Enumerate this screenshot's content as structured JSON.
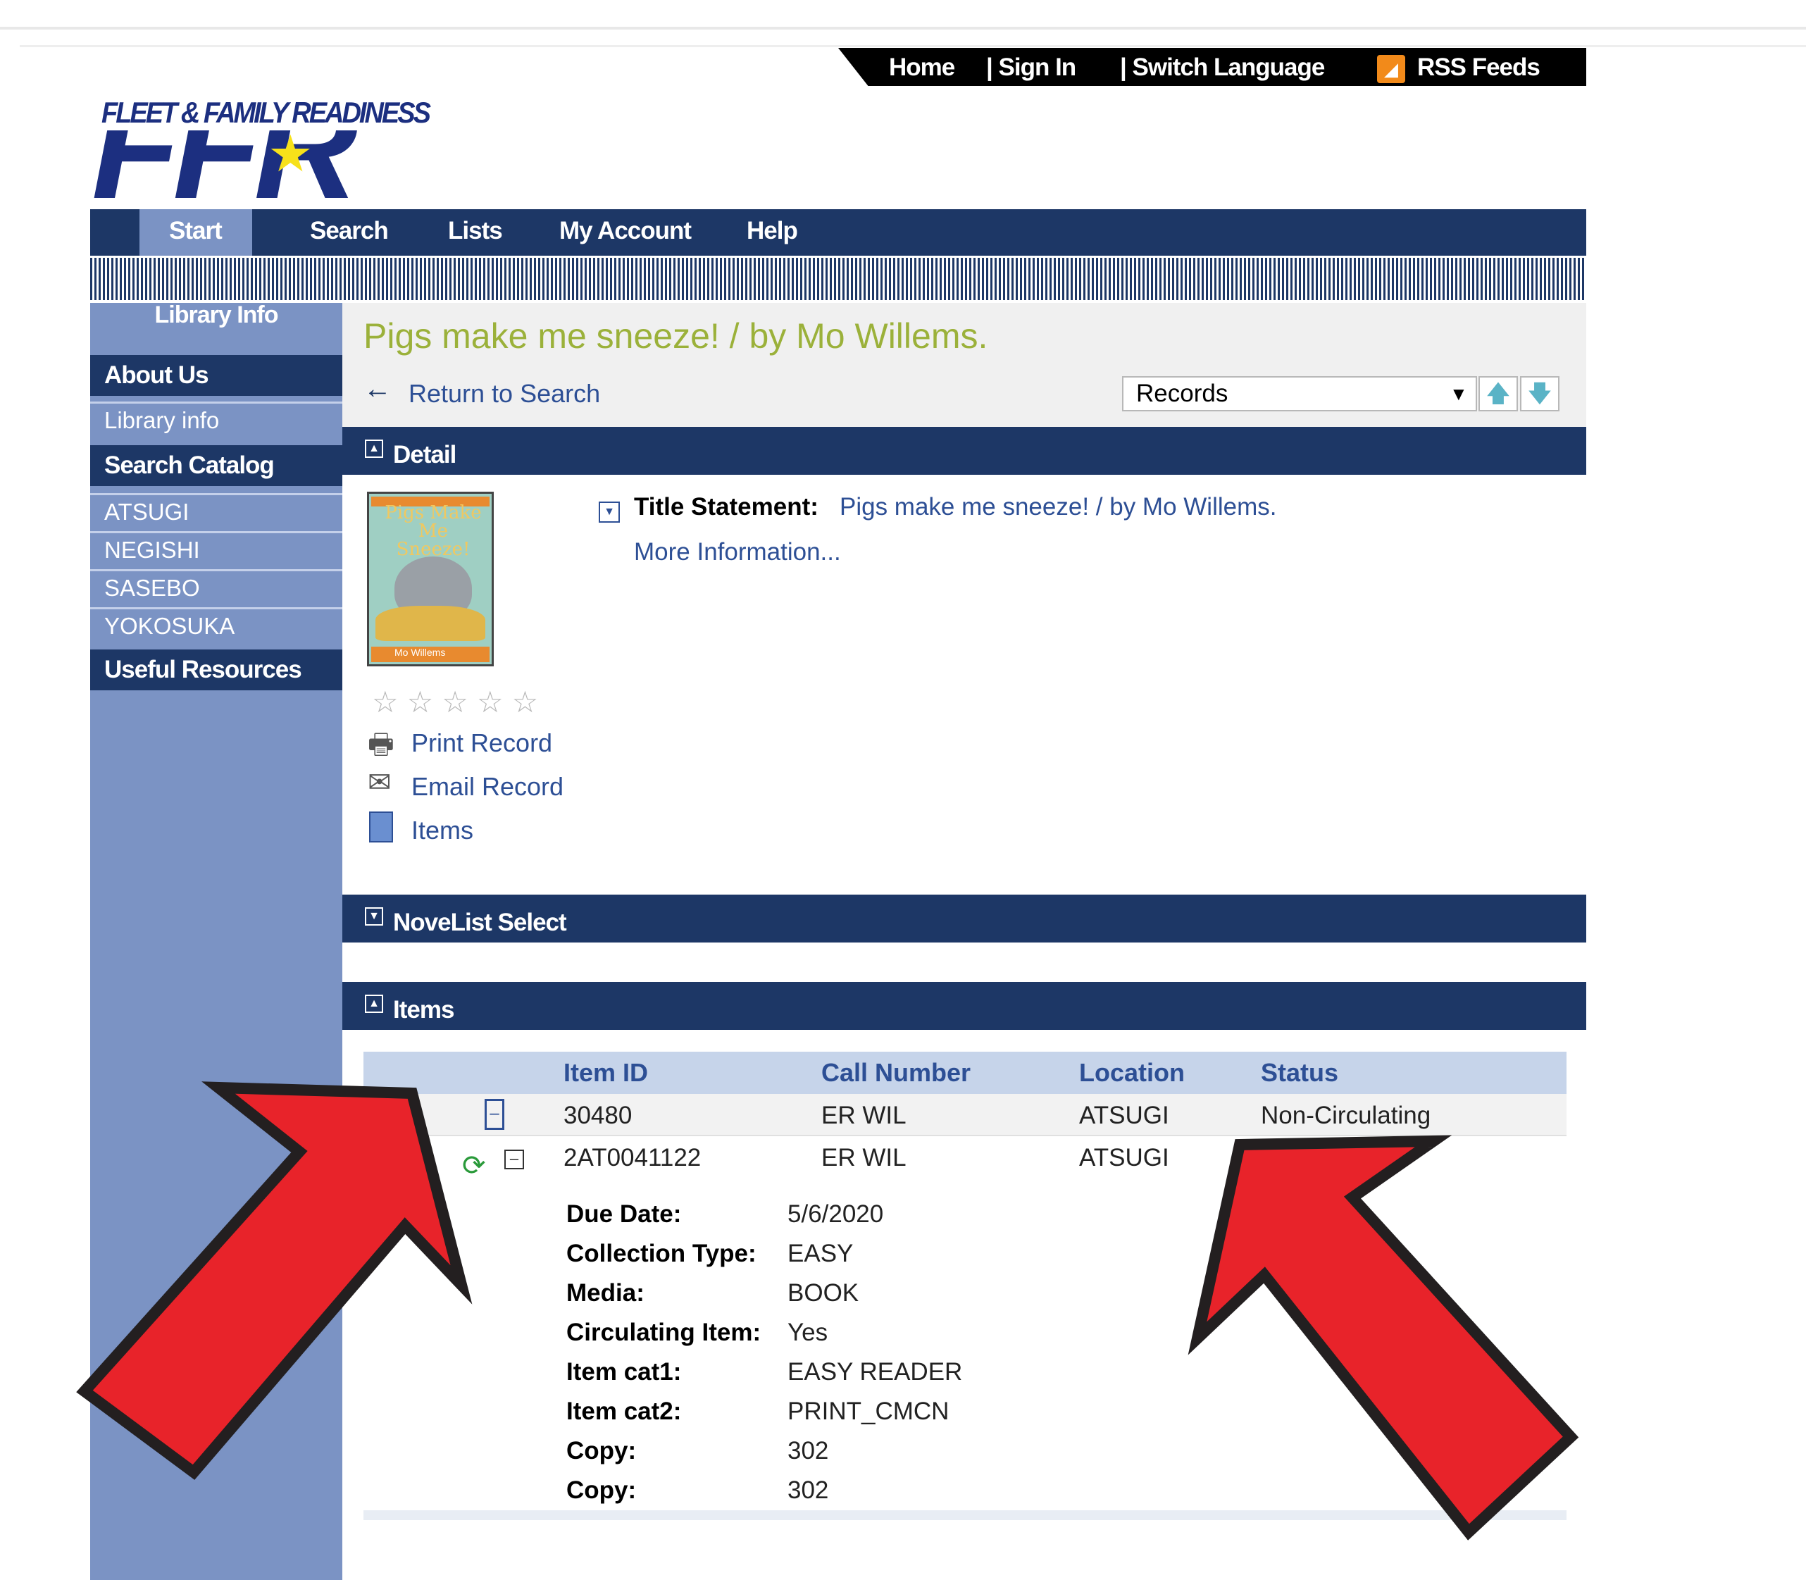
{
  "utility_links": [
    "Home",
    "| Sign In",
    "| Switch Language",
    "RSS Feeds"
  ],
  "logo": {
    "top_text": "FLEET & FAMILY READINESS",
    "big_text": "FFR"
  },
  "nav": {
    "tabs": [
      "Start",
      "Search",
      "Lists",
      "My Account",
      "Help"
    ],
    "active": "Start"
  },
  "sidebar": {
    "library_info": "Library Info",
    "about_us": "About Us",
    "library_info_link": "Library info",
    "search_catalog": "Search Catalog",
    "branches": [
      "ATSUGI",
      "NEGISHI",
      "SASEBO",
      "YOKOSUKA"
    ],
    "useful_resources": "Useful Resources"
  },
  "record": {
    "title": "Pigs make me sneeze! / by Mo Willems.",
    "return_to_search": "Return to Search",
    "records_select": "Records",
    "cover_text": "Pigs Make Me Sneeze!",
    "cover_author": "Mo Willems",
    "rating_stars": 0,
    "actions": [
      "Print Record",
      "Email Record",
      "Items"
    ],
    "title_statement_label": "Title Statement:",
    "title_statement_value": "Pigs make me sneeze! / by Mo Willems.",
    "more_information": "More Information..."
  },
  "sections": {
    "detail": "Detail",
    "novelist": "NoveList Select",
    "items": "Items"
  },
  "items_table": {
    "headers": [
      "Item ID",
      "Call Number",
      "Location",
      "Status"
    ],
    "rows": [
      {
        "item_id": "30480",
        "call_number": "ER WIL",
        "location": "ATSUGI",
        "status": "Non-Circulating"
      },
      {
        "item_id": "2AT0041122",
        "call_number": "ER WIL",
        "location": "ATSUGI",
        "status": ""
      }
    ],
    "details": [
      {
        "label": "Due Date:",
        "value": "5/6/2020"
      },
      {
        "label": "Collection Type:",
        "value": "EASY"
      },
      {
        "label": "Media:",
        "value": "BOOK"
      },
      {
        "label": "Circulating Item:",
        "value": "Yes"
      },
      {
        "label": "Item cat1:",
        "value": "EASY READER"
      },
      {
        "label": "Item cat2:",
        "value": "PRINT_CMCN"
      },
      {
        "label": "Copy:",
        "value": "302"
      },
      {
        "label": "Copy:",
        "value": "302"
      }
    ]
  },
  "colors": {
    "nav_dark": "#1d3766",
    "sidebar": "#7b93c4",
    "link": "#2d4f95",
    "title": "#9bb13a",
    "arrow": "#e8232a"
  }
}
